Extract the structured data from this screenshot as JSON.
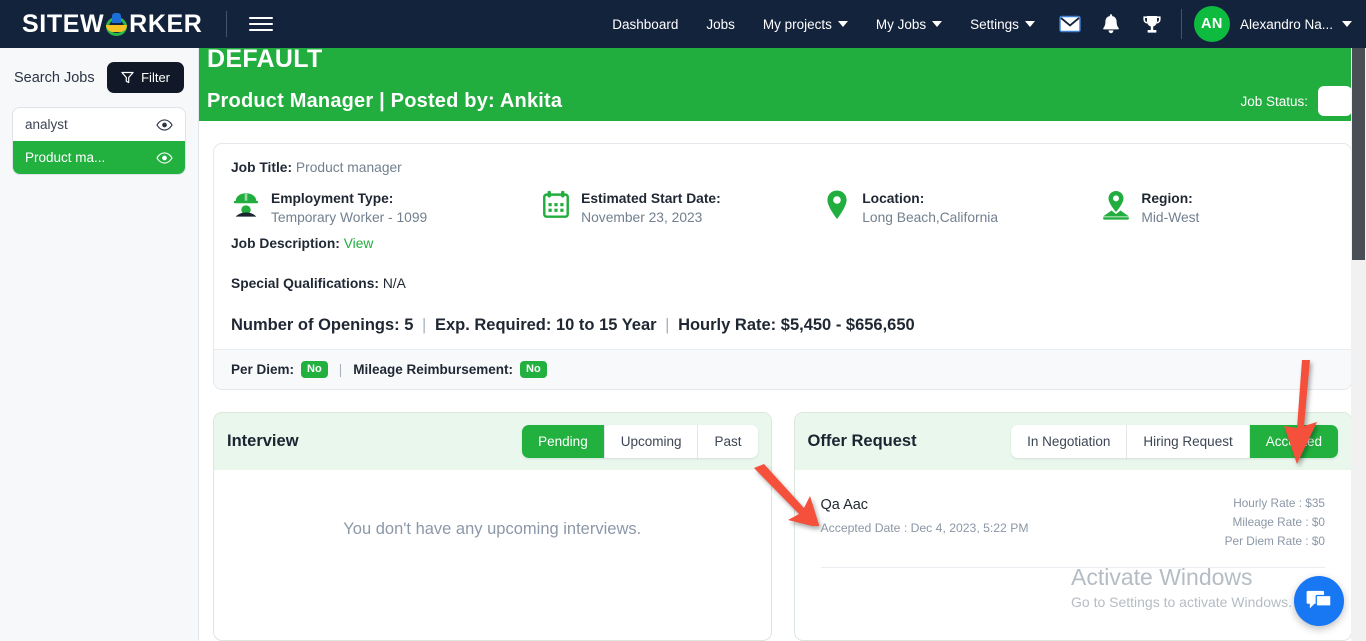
{
  "navbar": {
    "brand_left": "SITEW",
    "brand_right": "RKER",
    "logo_icon": "hardhat-icon",
    "menu_icon": "hamburger-icon",
    "links": [
      {
        "label": "Dashboard",
        "has_caret": false
      },
      {
        "label": "Jobs",
        "has_caret": false
      },
      {
        "label": "My projects",
        "has_caret": true
      },
      {
        "label": "My Jobs",
        "has_caret": true
      },
      {
        "label": "Settings",
        "has_caret": true
      }
    ],
    "icons": [
      "mail-icon",
      "bell-icon",
      "trophy-icon"
    ],
    "avatar_initials": "AN",
    "user_name": "Alexandro Na..."
  },
  "sidebar": {
    "title": "Search Jobs",
    "filter_label": "Filter",
    "filter_icon": "funnel-icon",
    "jobs": [
      {
        "label": "analyst",
        "selected": false,
        "icon": "eye-icon"
      },
      {
        "label": "Product ma...",
        "selected": true,
        "icon": "eye-icon"
      }
    ]
  },
  "header": {
    "default_label": "DEFAULT",
    "title": "Product Manager | Posted by: Ankita",
    "status_label": "Job Status:",
    "accent_green": "#22ad3f"
  },
  "job": {
    "job_title_label": "Job Title:",
    "job_title_value": "Product manager",
    "employment_type_label": "Employment Type:",
    "employment_type_value": "Temporary Worker - 1099",
    "employment_icon": "worker-hardhat-icon",
    "start_date_label": "Estimated Start Date:",
    "start_date_value": "November 23, 2023",
    "start_date_icon": "calendar-icon",
    "location_label": "Location:",
    "location_value": "Long Beach,California",
    "location_icon": "map-pin-icon",
    "region_label": "Region:",
    "region_value": "Mid-West",
    "region_icon": "region-pin-icon",
    "job_description_label": "Job Description:",
    "job_description_link": "View",
    "special_qualifications_label": "Special Qualifications:",
    "special_qualifications_value": "N/A",
    "openings_label": "Number of Openings:",
    "openings_value": "5",
    "experience_label": "Exp. Required:",
    "experience_value": "10 to 15 Year",
    "hourly_rate_label": "Hourly Rate:",
    "hourly_rate_value": "$5,450 - $656,650",
    "separator": "|",
    "per_diem_label": "Per Diem:",
    "per_diem_value": "No",
    "mileage_label": "Mileage Reimbursement:",
    "mileage_value": "No"
  },
  "interview_panel": {
    "title": "Interview",
    "tabs": [
      {
        "label": "Pending",
        "active": true
      },
      {
        "label": "Upcoming",
        "active": false
      },
      {
        "label": "Past",
        "active": false
      }
    ],
    "empty_message": "You don't have any upcoming interviews."
  },
  "offer_panel": {
    "title": "Offer Request",
    "tabs": [
      {
        "label": "In Negotiation",
        "active": false
      },
      {
        "label": "Hiring Request",
        "active": false
      },
      {
        "label": "Accepted",
        "active": true
      }
    ],
    "offer": {
      "name": "Qa Aac",
      "accepted_date": "Accepted Date : Dec 4, 2023, 5:22 PM",
      "hourly_rate": "Hourly Rate : $35",
      "mileage_rate": "Mileage Rate : $0",
      "per_diem_rate": "Per Diem Rate : $0"
    }
  },
  "annotations": {
    "arrow_color": "#f4503c",
    "arrow_accepted_target": "Accepted",
    "arrow_offer_target": "Qa Aac"
  },
  "watermark": {
    "line1": "Activate Windows",
    "line2": "Go to Settings to activate Windows."
  },
  "chat": {
    "icon": "chat-bubble-icon"
  }
}
